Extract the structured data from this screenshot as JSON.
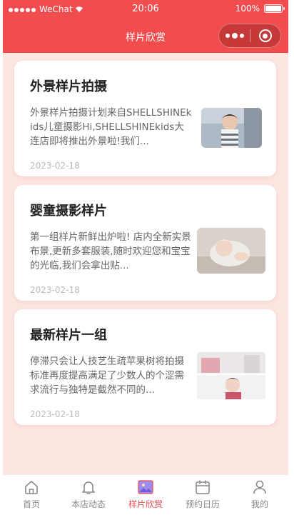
{
  "status_bar": {
    "carrier": "WeChat",
    "time": "20:06",
    "battery": "100%"
  },
  "nav": {
    "title": "样片欣赏"
  },
  "posts": [
    {
      "title": "外景样片拍摄",
      "description": "外景样片拍摄计划来自SHELLSHINEkids儿童摄影Hi,SHELLSHINEkids大连店即将推出外景啦!我们...",
      "date": "2023-02-18"
    },
    {
      "title": "婴童摄影样片",
      "description": "第一组样片新鲜出炉啦! 店内全新实景布景,更新多套服装,随时欢迎您和宝宝的光临,我们会拿出贴...",
      "date": "2023-02-18"
    },
    {
      "title": "最新样片一组",
      "description": "停滞只会让人技艺生疏苹果树将拍摄标准再度提高满足了少数人的个涩需求流行与独特是截然不同的...",
      "date": "2023-02-18"
    }
  ],
  "tabbar": {
    "items": [
      {
        "label": "首页",
        "icon": "home-icon"
      },
      {
        "label": "本店动态",
        "icon": "bell-icon"
      },
      {
        "label": "样片欣赏",
        "icon": "gallery-icon"
      },
      {
        "label": "预约日历",
        "icon": "calendar-icon"
      },
      {
        "label": "我的",
        "icon": "user-icon"
      }
    ],
    "active_index": 2
  },
  "colors": {
    "brand": "#f14c4e",
    "background": "#fde6e2"
  }
}
